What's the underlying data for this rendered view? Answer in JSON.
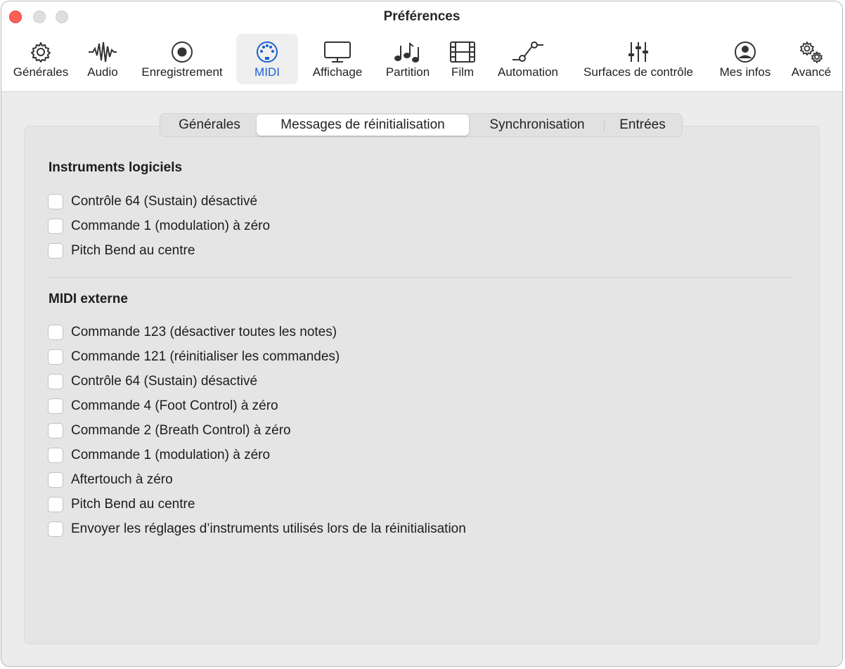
{
  "window": {
    "title": "Préférences"
  },
  "toolbar": {
    "items": [
      {
        "label": "Générales",
        "icon": "gear-icon"
      },
      {
        "label": "Audio",
        "icon": "waveform-icon"
      },
      {
        "label": "Enregistrement",
        "icon": "record-icon"
      },
      {
        "label": "MIDI",
        "icon": "midi-port-icon"
      },
      {
        "label": "Affichage",
        "icon": "display-icon"
      },
      {
        "label": "Partition",
        "icon": "music-notes-icon"
      },
      {
        "label": "Film",
        "icon": "film-icon"
      },
      {
        "label": "Automation",
        "icon": "automation-curve-icon"
      },
      {
        "label": "Surfaces de contrôle",
        "icon": "faders-icon"
      },
      {
        "label": "Mes infos",
        "icon": "person-icon"
      },
      {
        "label": "Avancé",
        "icon": "gears-icon"
      }
    ],
    "active": "MIDI",
    "accent_color": "#1a5fd0"
  },
  "tabs": {
    "items": [
      "Générales",
      "Messages de réinitialisation",
      "Synchronisation",
      "Entrées"
    ],
    "active": "Messages de réinitialisation"
  },
  "software_instruments": {
    "title": "Instruments logiciels",
    "options": [
      {
        "label": "Contrôle 64 (Sustain) désactivé",
        "checked": false
      },
      {
        "label": "Commande 1 (modulation) à zéro",
        "checked": false
      },
      {
        "label": "Pitch Bend au centre",
        "checked": false
      }
    ]
  },
  "external_midi": {
    "title": "MIDI externe",
    "options": [
      {
        "label": "Commande 123 (désactiver toutes les notes)",
        "checked": false
      },
      {
        "label": "Commande 121 (réinitialiser les commandes)",
        "checked": false
      },
      {
        "label": "Contrôle 64 (Sustain) désactivé",
        "checked": false
      },
      {
        "label": "Commande 4 (Foot Control) à zéro",
        "checked": false
      },
      {
        "label": "Commande 2 (Breath Control) à zéro",
        "checked": false
      },
      {
        "label": "Commande 1 (modulation) à zéro",
        "checked": false
      },
      {
        "label": "Aftertouch à zéro",
        "checked": false
      },
      {
        "label": "Pitch Bend au centre",
        "checked": false
      },
      {
        "label": "Envoyer les réglages d’instruments utilisés lors de la réinitialisation",
        "checked": false
      }
    ]
  }
}
